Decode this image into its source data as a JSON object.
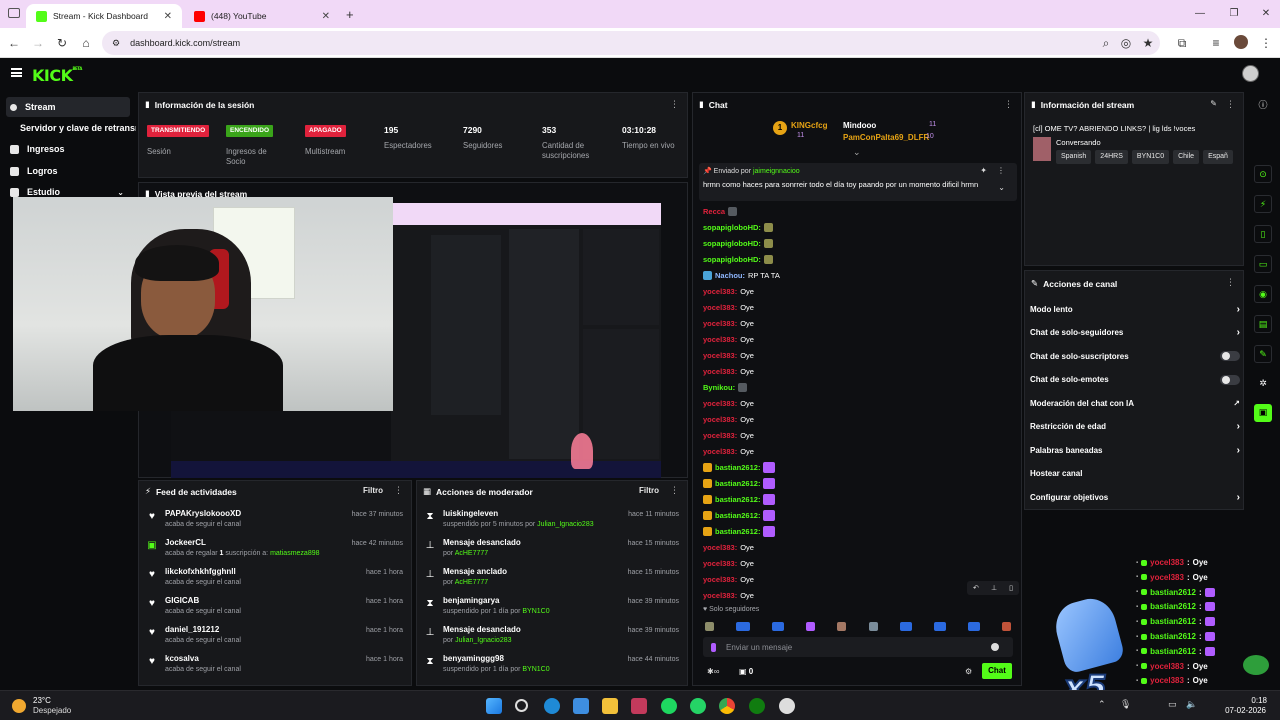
{
  "browser": {
    "tabs": [
      {
        "title": "Stream - Kick Dashboard",
        "favicon_color": "#53fc18"
      },
      {
        "title": "(448) YouTube",
        "favicon_color": "#ff0000"
      }
    ],
    "new_tab": "+",
    "url": "dashboard.kick.com/stream"
  },
  "kick": {
    "logo": "KICK",
    "logo_sup": "BETA"
  },
  "sidebar": {
    "items": [
      {
        "label": "Stream"
      },
      {
        "label": "Servidor y clave de retransmisión"
      },
      {
        "label": "Ingresos"
      },
      {
        "label": "Logros"
      },
      {
        "label": "Estudio"
      }
    ]
  },
  "session": {
    "title": "Información de la sesión",
    "badges": [
      {
        "text": "TRANSMITIENDO",
        "label": "Sesión",
        "color": "#e0223c"
      },
      {
        "text": "ENCENDIDO",
        "label": "Ingresos de Socio",
        "color": "#3aa41a"
      },
      {
        "text": "APAGADO",
        "label": "Multistream",
        "color": "#e0223c"
      }
    ],
    "stats": [
      {
        "value": "195",
        "label": "Espectadores"
      },
      {
        "value": "7290",
        "label": "Seguidores"
      },
      {
        "value": "353",
        "label": "Cantidad de suscripciones"
      },
      {
        "value": "03:10:28",
        "label": "Tiempo en vivo"
      }
    ]
  },
  "preview": {
    "title": "Vista previa del stream"
  },
  "feed": {
    "title": "Feed de actividades",
    "filter": "Filtro",
    "rows": [
      {
        "name": "PAPAKryslokoooXD",
        "sub": "acaba de seguir el canal",
        "time": "hace 37 minutos",
        "icon": "heart"
      },
      {
        "name": "JockeerCL",
        "sub": "acaba de regalar ",
        "sub_count": "1",
        "sub_mid": " suscripción a: ",
        "sub_user": "matiasmeza898",
        "time": "hace 42 minutos",
        "icon": "gift"
      },
      {
        "name": "likckofxhkhfgghnll",
        "sub": "acaba de seguir el canal",
        "time": "hace 1 hora",
        "icon": "heart"
      },
      {
        "name": "GIGICAB",
        "sub": "acaba de seguir el canal",
        "time": "hace 1 hora",
        "icon": "heart"
      },
      {
        "name": "daniel_191212",
        "sub": "acaba de seguir el canal",
        "time": "hace 1 hora",
        "icon": "heart"
      },
      {
        "name": "kcosalva",
        "sub": "acaba de seguir el canal",
        "time": "hace 1 hora",
        "icon": "heart"
      }
    ]
  },
  "modactions": {
    "title": "Acciones de moderador",
    "filter": "Filtro",
    "rows": [
      {
        "name": "luiskingeleven",
        "sub": "suspendido por 5 minutos por ",
        "user": "Julian_Ignacio283",
        "time": "hace 11 minutos",
        "icon": "hourglass"
      },
      {
        "name": "Mensaje desanclado",
        "sub": "por ",
        "user": "AcHE7777",
        "time": "hace 15 minutos",
        "icon": "pin"
      },
      {
        "name": "Mensaje anclado",
        "sub": "por ",
        "user": "AcHE7777",
        "time": "hace 15 minutos",
        "icon": "pin"
      },
      {
        "name": "benjamingarya",
        "sub": "suspendido por 1 día por ",
        "user": "BYN1C0",
        "time": "hace 39 minutos",
        "icon": "hourglass"
      },
      {
        "name": "Mensaje desanclado",
        "sub": "por ",
        "user": "Julian_Ignacio283",
        "time": "hace 39 minutos",
        "icon": "pin"
      },
      {
        "name": "benyaminggg98",
        "sub": "suspendido por 1 día por ",
        "user": "BYN1C0",
        "time": "hace 44 minutos",
        "icon": "hourglass"
      }
    ]
  },
  "chat": {
    "title": "Chat",
    "top": [
      {
        "rank": "1",
        "user": "KINGcfcg",
        "count": "11"
      },
      {
        "user": "Mindooo",
        "count": "11"
      },
      {
        "user": "PamConPalta69_DLFR",
        "count": "10"
      }
    ],
    "pinned": {
      "by_label": "Enviado por ",
      "by_user": "jaimeignnacioo",
      "text": "hrmn como haces para sonrreir todo el día toy paando por un momento dificil hrmn"
    },
    "lines": [
      {
        "user": "Recca",
        "text": "",
        "cls": "u-red"
      },
      {
        "user": "sopapigloboHD:",
        "text": "",
        "cls": "u-green"
      },
      {
        "user": "sopapigloboHD:",
        "text": "",
        "cls": "u-green"
      },
      {
        "user": "sopapigloboHD:",
        "text": "",
        "cls": "u-green"
      },
      {
        "user": "Nachou:",
        "text": "RP TA TA",
        "cls": "u-blue"
      },
      {
        "user": "yocel383:",
        "text": "Oye",
        "cls": "u-red"
      },
      {
        "user": "yocel383:",
        "text": "Oye",
        "cls": "u-red"
      },
      {
        "user": "yocel383:",
        "text": "Oye",
        "cls": "u-red"
      },
      {
        "user": "yocel383:",
        "text": "Oye",
        "cls": "u-red"
      },
      {
        "user": "yocel383:",
        "text": "Oye",
        "cls": "u-red"
      },
      {
        "user": "yocel383:",
        "text": "Oye",
        "cls": "u-red"
      },
      {
        "user": "Bynikou:",
        "text": "",
        "cls": "u-green"
      },
      {
        "user": "yocel383:",
        "text": "Oye",
        "cls": "u-red"
      },
      {
        "user": "yocel383:",
        "text": "Oye",
        "cls": "u-red"
      },
      {
        "user": "yocel383:",
        "text": "Oye",
        "cls": "u-red"
      },
      {
        "user": "yocel383:",
        "text": "Oye",
        "cls": "u-red"
      },
      {
        "user": "bastian2612:",
        "text": "",
        "cls": "u-green"
      },
      {
        "user": "bastian2612:",
        "text": "",
        "cls": "u-green"
      },
      {
        "user": "bastian2612:",
        "text": "",
        "cls": "u-green"
      },
      {
        "user": "bastian2612:",
        "text": "",
        "cls": "u-green"
      },
      {
        "user": "bastian2612:",
        "text": "",
        "cls": "u-green"
      },
      {
        "user": "yocel383:",
        "text": "Oye",
        "cls": "u-red"
      },
      {
        "user": "yocel383:",
        "text": "Oye",
        "cls": "u-red"
      },
      {
        "user": "yocel383:",
        "text": "Oye",
        "cls": "u-red"
      },
      {
        "user": "yocel383:",
        "text": "Oye",
        "cls": "u-red"
      }
    ],
    "mode": "Solo seguidores",
    "placeholder": "Enviar un mensaje",
    "count": "0",
    "send": "Chat"
  },
  "streaminfo": {
    "title": "Información del stream",
    "stream_title": "[cl] OME TV? ABRIENDO LINKS? | lig lds !voces",
    "category": "Conversando",
    "tags": [
      "Spanish",
      "24HRS",
      "BYN1C0",
      "Chile",
      "Españ"
    ]
  },
  "actions": {
    "title": "Acciones de canal",
    "rows": [
      {
        "label": "Modo lento",
        "kind": "chevron"
      },
      {
        "label": "Chat de solo-seguidores",
        "kind": "chevron"
      },
      {
        "label": "Chat de solo-suscriptores",
        "kind": "toggle"
      },
      {
        "label": "Chat de solo-emotes",
        "kind": "toggle"
      },
      {
        "label": "Moderación del chat con IA",
        "kind": "external"
      },
      {
        "label": "Restricción de edad",
        "kind": "chevron"
      },
      {
        "label": "Palabras baneadas",
        "kind": "chevron"
      },
      {
        "label": "Hostear canal",
        "kind": "none"
      },
      {
        "label": "Configurar objetivos",
        "kind": "chevron"
      }
    ]
  },
  "overlay": {
    "lines": [
      {
        "user": "yocel383",
        "text": "Oye"
      },
      {
        "user": "yocel383",
        "text": "Oye"
      },
      {
        "user": "bastian2612",
        "text": ""
      },
      {
        "user": "bastian2612",
        "text": ""
      },
      {
        "user": "bastian2612",
        "text": ""
      },
      {
        "user": "bastian2612",
        "text": ""
      },
      {
        "user": "bastian2612",
        "text": ""
      },
      {
        "user": "yocel383",
        "text": "Oye"
      },
      {
        "user": "yocel383",
        "text": "Oye"
      },
      {
        "user": "yocel383",
        "text": "Oye"
      }
    ],
    "multiplier": "x5"
  },
  "taskbar": {
    "temp": "23°C",
    "weather": "Despejado",
    "time": "0:18",
    "date": "07-02-2026"
  },
  "colors": {
    "kick_green": "#53fc18",
    "live_red": "#e0223c",
    "panel": "#17181b"
  }
}
